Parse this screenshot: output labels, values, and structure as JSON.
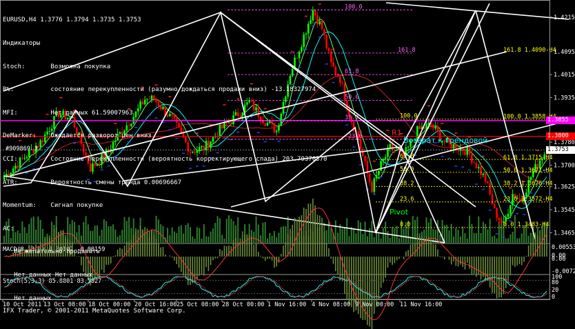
{
  "header": {
    "symbol": "EURUSD,H4",
    "ohlc": "1.3776 1.3794 1.3735 1.3753",
    "indicators_title": "Индикаторы"
  },
  "indicator_panel": [
    {
      "name": "Stoch:",
      "text": "Возможна покупка"
    },
    {
      "name": "R%:",
      "text": "состояние перекупленности (разумно дождаться продажи вниз) -13.18327974"
    },
    {
      "name": "MFI:",
      "text": "Нет данных 61.59007963"
    },
    {
      "name": "DeMarker:",
      "text": "Ожидается разворот цен вниз"
    },
    {
      "name": "CCI:",
      "text": "Состояние перекупленности (вероятность корректирующего спада) 203.79370370"
    },
    {
      "name": "ATR:",
      "text": "Вероятность смены тренда 0.00696667"
    },
    {
      "name": "Momentum:",
      "text": "Сигнал покупке"
    },
    {
      "name": "AC:",
      "text": ""
    },
    {
      "name": "",
      "text": "Не желательно продавать"
    },
    {
      "name": "",
      "text": "Нет данных Нет данных"
    },
    {
      "name": "",
      "text": "Нет данных"
    }
  ],
  "annotations": {
    "trend_return": "Возврат к трендовой",
    "pivot": "Pivot",
    "r1": "R1",
    "left_label": "#909869",
    "left_label_num": "3"
  },
  "fib_small": [
    {
      "label": "100.0",
      "price": 1.424
    },
    {
      "label": "161.8",
      "price": 1.409
    },
    {
      "label": "61.8",
      "price": 1.4015
    },
    {
      "label": "50.0",
      "price": 1.3925
    },
    {
      "label": "38.2",
      "price": 1.3855
    },
    {
      "label": "23.6",
      "price": 1.379
    }
  ],
  "fib_right": [
    {
      "label": "100.0",
      "price": 1.386
    },
    {
      "label": "61.8",
      "price": 1.372
    },
    {
      "label": "50.0",
      "price": 1.3675
    },
    {
      "label": "38.2",
      "price": 1.3626
    },
    {
      "label": "23.6",
      "price": 1.3572
    },
    {
      "label": "0.0",
      "price": 1.3483
    }
  ],
  "fib_far_right": [
    {
      "label": "161.8 1.4090-H4",
      "price": 1.409
    },
    {
      "label": "100.0 1.3858-H4",
      "price": 1.3858
    },
    {
      "label": "61.8 1.3715-H4",
      "price": 1.3715
    },
    {
      "label": "50.0 1.3671-H4",
      "price": 1.3671
    },
    {
      "label": "38.2 1.3626-H4",
      "price": 1.3626
    },
    {
      "label": "23.6 1.3572-H4",
      "price": 1.3572
    },
    {
      "label": "0.0 1.3483-H4",
      "price": 1.3483
    }
  ],
  "price_boxes": [
    {
      "price": "1.3855",
      "bg": "#ff00ff",
      "fg": "#ffffff"
    },
    {
      "price": "1.3800",
      "bg": "#ff0000",
      "fg": "#ffffff"
    },
    {
      "price": "1.3753",
      "bg": "#ffffff",
      "fg": "#000000"
    }
  ],
  "macd": {
    "label": "MACD(8,13,9) 0.00107 -0.00159",
    "axis": [
      "0.00553",
      "0.00",
      "0.00",
      "-0.00726"
    ]
  },
  "stoch": {
    "label": "Stoch(5,3,3) 85.8801 83.5827",
    "axis": [
      "100",
      "80",
      "20",
      "0"
    ]
  },
  "credit": "IFX Trader, © 2001-2011 MetaQuotes Software Corp.",
  "colors": {
    "bull": "#00ff00",
    "bear": "#ff0000",
    "fib_small": "#ff66ff",
    "fib_right": "#ffff00",
    "trend": "#ffffff",
    "ma_cyan": "#00ffff",
    "signal_blue": "#2244ff"
  },
  "chart_data": {
    "type": "candlestick",
    "symbol": "EURUSD",
    "timeframe": "H4",
    "ylim": [
      1.343,
      1.426
    ],
    "y_ticks": [
      "1.4215",
      "1.4095",
      "1.4015",
      "1.3935",
      "1.3780",
      "1.3700",
      "1.3625",
      "1.3545",
      "1.3465"
    ],
    "x_ticks": [
      "10 Oct 2011",
      "13 Oct 08:00",
      "18 Oct 00:00",
      "20 Oct 16:00",
      "25 Oct 08:00",
      "28 Oct 00:00",
      "1 Nov 16:00",
      "4 Nov 08:00",
      "9 Nov 00:00",
      "11 Nov 16:00"
    ],
    "close_path": [
      [
        0,
        1.366
      ],
      [
        8,
        1.372
      ],
      [
        16,
        1.378
      ],
      [
        24,
        1.388
      ],
      [
        30,
        1.386
      ],
      [
        38,
        1.369
      ],
      [
        44,
        1.373
      ],
      [
        50,
        1.38
      ],
      [
        58,
        1.388
      ],
      [
        62,
        1.393
      ],
      [
        66,
        1.393
      ],
      [
        74,
        1.386
      ],
      [
        82,
        1.375
      ],
      [
        88,
        1.376
      ],
      [
        96,
        1.383
      ],
      [
        102,
        1.387
      ],
      [
        108,
        1.392
      ],
      [
        114,
        1.386
      ],
      [
        120,
        1.382
      ],
      [
        126,
        1.402
      ],
      [
        132,
        1.415
      ],
      [
        136,
        1.424
      ],
      [
        140,
        1.4175
      ],
      [
        144,
        1.405
      ],
      [
        148,
        1.4
      ],
      [
        152,
        1.388
      ],
      [
        156,
        1.379
      ],
      [
        160,
        1.367
      ],
      [
        162,
        1.362
      ],
      [
        166,
        1.37
      ],
      [
        170,
        1.376
      ],
      [
        176,
        1.373
      ],
      [
        182,
        1.382
      ],
      [
        188,
        1.384
      ],
      [
        194,
        1.378
      ],
      [
        200,
        1.376
      ],
      [
        204,
        1.375
      ],
      [
        208,
        1.37
      ],
      [
        212,
        1.365
      ],
      [
        216,
        1.354
      ],
      [
        220,
        1.349
      ],
      [
        224,
        1.36
      ],
      [
        228,
        1.358
      ],
      [
        232,
        1.366
      ],
      [
        236,
        1.372
      ],
      [
        239,
        1.3753
      ]
    ]
  }
}
